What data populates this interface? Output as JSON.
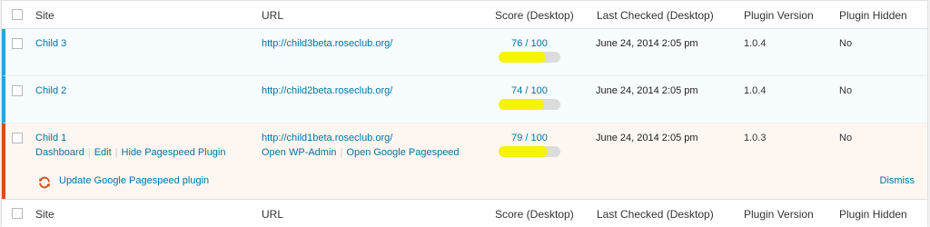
{
  "columns": {
    "site": "Site",
    "url": "URL",
    "score": "Score (Desktop)",
    "last_checked": "Last Checked (Desktop)",
    "plugin_version": "Plugin Version",
    "plugin_hidden": "Plugin Hidden"
  },
  "rows": [
    {
      "site": "Child 3",
      "url": "http://child3beta.roseclub.org/",
      "score_text": "76 / 100",
      "score": 0.76,
      "last_checked": "June 24, 2014 2:05 pm",
      "plugin_version": "1.0.4",
      "plugin_hidden": "No"
    },
    {
      "site": "Child 2",
      "url": "http://child2beta.roseclub.org/",
      "score_text": "74 / 100",
      "score": 0.74,
      "last_checked": "June 24, 2014 2:05 pm",
      "plugin_version": "1.0.4",
      "plugin_hidden": "No"
    },
    {
      "site": "Child 1",
      "url": "http://child1beta.roseclub.org/",
      "score_text": "79 / 100",
      "score": 0.79,
      "last_checked": "June 24, 2014 2:05 pm",
      "plugin_version": "1.0.3",
      "plugin_hidden": "No",
      "site_actions": [
        "Dashboard",
        "Edit",
        "Hide Pagespeed Plugin"
      ],
      "url_actions": [
        "Open WP-Admin",
        "Open Google Pagespeed"
      ],
      "update_notice": "Update Google Pagespeed plugin",
      "dismiss": "Dismiss"
    }
  ],
  "colors": {
    "link": "#0074a2",
    "active_border": "#2ea2cc",
    "update_border": "#d54e21",
    "score_fill": "#f6f400"
  }
}
